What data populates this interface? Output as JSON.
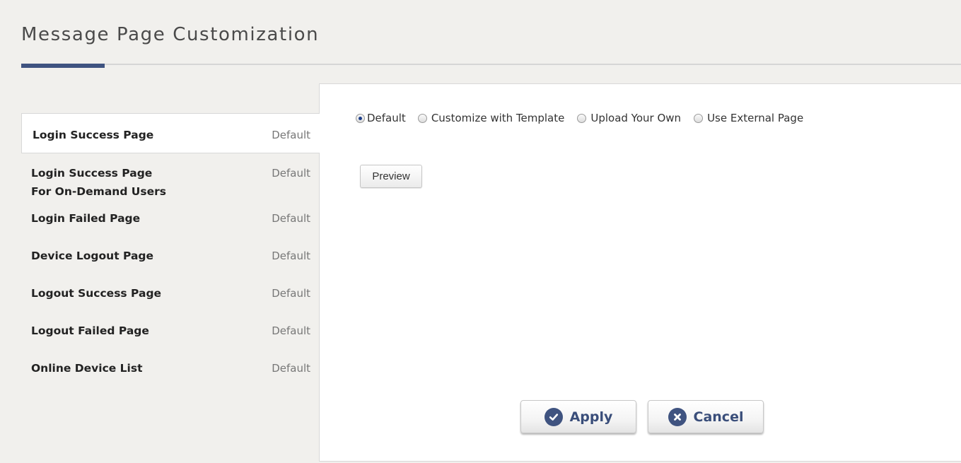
{
  "page": {
    "title": "Message Page Customization"
  },
  "sidebar": {
    "items": [
      {
        "label_line1": "Login Success Page",
        "label_line2": "",
        "status": "Default",
        "active": true
      },
      {
        "label_line1": "Login Success Page",
        "label_line2": "For On-Demand Users",
        "status": "Default",
        "active": false
      },
      {
        "label_line1": "Login Failed Page",
        "label_line2": "",
        "status": "Default",
        "active": false
      },
      {
        "label_line1": "Device Logout Page",
        "label_line2": "",
        "status": "Default",
        "active": false
      },
      {
        "label_line1": "Logout Success Page",
        "label_line2": "",
        "status": "Default",
        "active": false
      },
      {
        "label_line1": "Logout Failed Page",
        "label_line2": "",
        "status": "Default",
        "active": false
      },
      {
        "label_line1": "Online Device List",
        "label_line2": "",
        "status": "Default",
        "active": false
      }
    ]
  },
  "options": {
    "selected": "Default",
    "items": [
      "Default",
      "Customize with Template",
      "Upload Your Own",
      "Use External Page"
    ]
  },
  "preview": {
    "label": "Preview"
  },
  "actions": {
    "apply": {
      "label": "Apply",
      "icon": "check-circle-icon"
    },
    "cancel": {
      "label": "Cancel",
      "icon": "close-circle-icon"
    }
  },
  "colors": {
    "accent": "#3f5380",
    "radio_selected": "#1e3f8a",
    "background": "#f1f0ed"
  }
}
